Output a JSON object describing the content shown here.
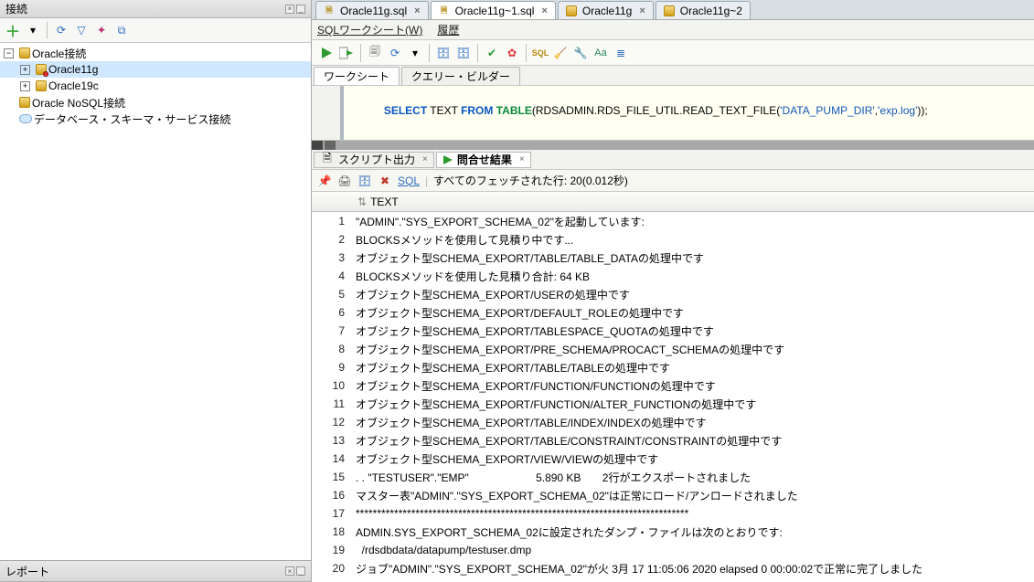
{
  "sidebar": {
    "panel_title": "接続",
    "items": [
      {
        "label": "Oracle接続",
        "expanded": true,
        "children": [
          {
            "label": "Oracle11g",
            "selected": true
          },
          {
            "label": "Oracle19c"
          }
        ]
      },
      {
        "label": "Oracle NoSQL接続"
      },
      {
        "label": "データベース・スキーマ・サービス接続"
      }
    ],
    "reports_title": "レポート"
  },
  "editor_tabs": [
    {
      "label": "Oracle11g.sql",
      "closable": true,
      "active": false,
      "icon": "sql-icon"
    },
    {
      "label": "Oracle11g~1.sql",
      "closable": true,
      "active": true,
      "icon": "sql-icon"
    },
    {
      "label": "Oracle11g",
      "closable": true,
      "active": false,
      "icon": "db-icon"
    },
    {
      "label": "Oracle11g~2",
      "closable": false,
      "active": false,
      "icon": "db-icon"
    }
  ],
  "subheader": {
    "worksheet": "SQLワークシート(W)",
    "history": "履歴"
  },
  "worksheet_tabs": [
    {
      "label": "ワークシート",
      "active": true
    },
    {
      "label": "クエリー・ビルダー",
      "active": false
    }
  ],
  "sql": {
    "tokens": [
      "SELECT",
      " TEXT ",
      "FROM",
      " ",
      "TABLE",
      "(RDSADMIN.RDS_FILE_UTIL.READ_TEXT_FILE(",
      "'DATA_PUMP_DIR'",
      ",",
      "'exp.log'",
      "));"
    ]
  },
  "result_tabs": [
    {
      "label": "スクリプト出力",
      "active": false,
      "icon": "script-icon"
    },
    {
      "label": "問合せ結果",
      "active": true,
      "icon": "run-icon"
    }
  ],
  "result_toolbar": {
    "sql": "SQL",
    "status": "すべてのフェッチされた行: 20(0.012秒)"
  },
  "grid": {
    "column": "TEXT",
    "rows": [
      "\"ADMIN\".\"SYS_EXPORT_SCHEMA_02\"を起動しています:",
      "BLOCKSメソッドを使用して見積り中です...",
      "オブジェクト型SCHEMA_EXPORT/TABLE/TABLE_DATAの処理中です",
      "BLOCKSメソッドを使用した見積り合計: 64 KB",
      "オブジェクト型SCHEMA_EXPORT/USERの処理中です",
      "オブジェクト型SCHEMA_EXPORT/DEFAULT_ROLEの処理中です",
      "オブジェクト型SCHEMA_EXPORT/TABLESPACE_QUOTAの処理中です",
      "オブジェクト型SCHEMA_EXPORT/PRE_SCHEMA/PROCACT_SCHEMAの処理中です",
      "オブジェクト型SCHEMA_EXPORT/TABLE/TABLEの処理中です",
      "オブジェクト型SCHEMA_EXPORT/FUNCTION/FUNCTIONの処理中です",
      "オブジェクト型SCHEMA_EXPORT/FUNCTION/ALTER_FUNCTIONの処理中です",
      "オブジェクト型SCHEMA_EXPORT/TABLE/INDEX/INDEXの処理中です",
      "オブジェクト型SCHEMA_EXPORT/TABLE/CONSTRAINT/CONSTRAINTの処理中です",
      "オブジェクト型SCHEMA_EXPORT/VIEW/VIEWの処理中です",
      ". . \"TESTUSER\".\"EMP\"                      5.890 KB       2行がエクスポートされました",
      "マスター表\"ADMIN\".\"SYS_EXPORT_SCHEMA_02\"は正常にロード/アンロードされました",
      "******************************************************************************",
      "ADMIN.SYS_EXPORT_SCHEMA_02に設定されたダンプ・ファイルは次のとおりです:",
      "  /rdsdbdata/datapump/testuser.dmp",
      "ジョブ\"ADMIN\".\"SYS_EXPORT_SCHEMA_02\"が火 3月 17 11:05:06 2020 elapsed 0 00:00:02で正常に完了しました"
    ]
  }
}
